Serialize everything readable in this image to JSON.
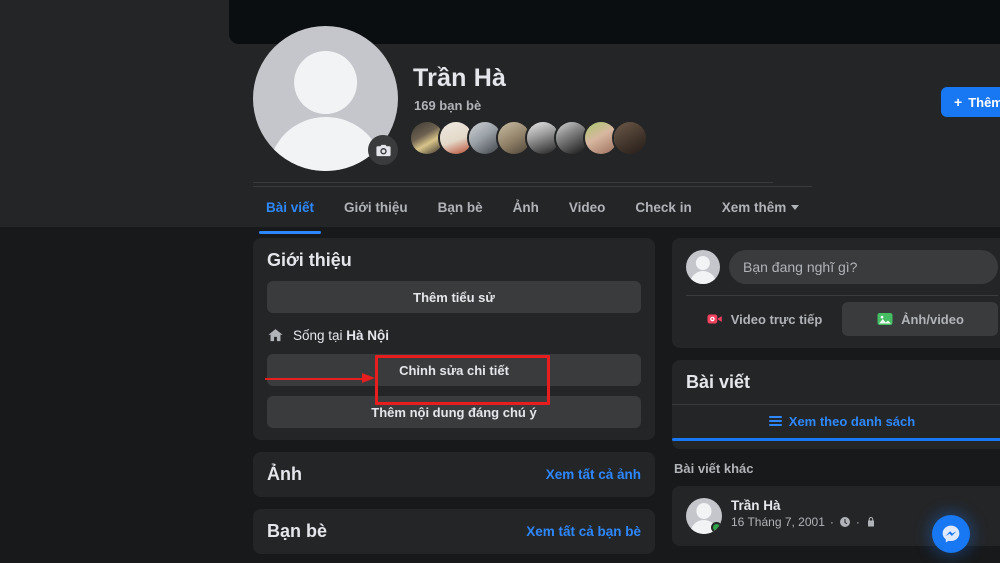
{
  "profile": {
    "name": "Trần Hà",
    "friend_count": "169 bạn bè",
    "camera_icon": "camera-icon",
    "avatar_icon": "default-avatar-icon",
    "add_button": {
      "plus": "+",
      "label": "Thêm"
    }
  },
  "tabs": [
    {
      "label": "Bài viết",
      "active": true
    },
    {
      "label": "Giới thiệu",
      "active": false
    },
    {
      "label": "Bạn bè",
      "active": false
    },
    {
      "label": "Ảnh",
      "active": false
    },
    {
      "label": "Video",
      "active": false
    },
    {
      "label": "Check in",
      "active": false
    },
    {
      "label": "Xem thêm",
      "active": false,
      "caret": true
    }
  ],
  "intro": {
    "title": "Giới thiệu",
    "add_bio": "Thêm tiểu sử",
    "lives_in_prefix": "Sống tại ",
    "lives_in_place": "Hà Nội",
    "home_icon": "home-icon",
    "edit_details": "Chỉnh sửa chi tiết",
    "add_featured": "Thêm nội dung đáng chú ý"
  },
  "photos": {
    "title": "Ảnh",
    "see_all": "Xem tất cả ảnh"
  },
  "friends": {
    "title": "Bạn bè",
    "see_all": "Xem tất cả bạn bè"
  },
  "composer": {
    "placeholder": "Bạn đang nghĩ gì?",
    "live_video": "Video trực tiếp",
    "live_video_icon": "live-video-icon",
    "photo_video": "Ảnh/video",
    "photo_video_icon": "photo-video-icon"
  },
  "posts_card": {
    "title": "Bài viết",
    "list_view": "Xem theo danh sách",
    "list_icon": "list-bars-icon"
  },
  "other_posts": {
    "label": "Bài viết khác",
    "post": {
      "author": "Trần Hà",
      "date": "16 Tháng 7, 2001",
      "separator": "·",
      "clock_icon": "clock-icon",
      "privacy_icon": "lock-icon"
    }
  },
  "fab": {
    "icon": "messenger-fab-icon"
  },
  "annotation": {
    "color": "#e81e1e",
    "target": "Chỉnh sửa chi tiết"
  },
  "colors": {
    "accent": "#1877f2",
    "link": "#2d88ff",
    "card_bg": "#242526",
    "page_bg": "#18191a",
    "pill_bg": "#3a3b3c",
    "online": "#31a24c",
    "annotation": "#e81e1e"
  }
}
